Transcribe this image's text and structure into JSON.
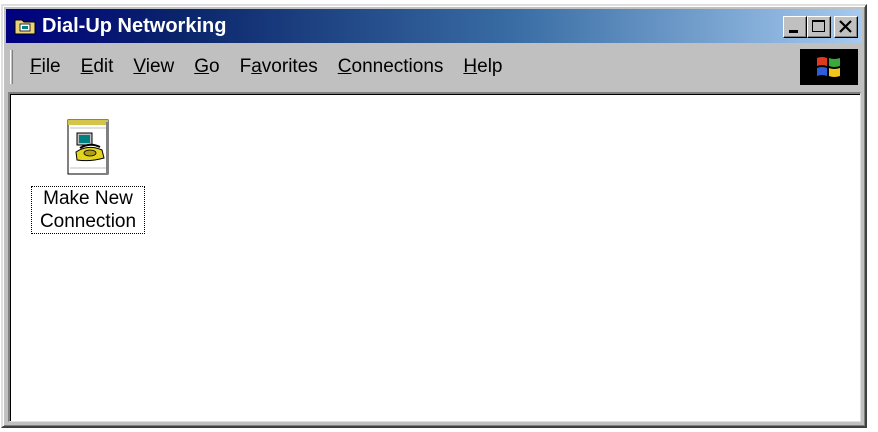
{
  "window": {
    "title": "Dial-Up Networking",
    "title_icon": "dial-up-folder-icon",
    "buttons": [
      "minimize",
      "maximize",
      "close"
    ]
  },
  "menubar": {
    "items": [
      {
        "label": "File",
        "accel": "F"
      },
      {
        "label": "Edit",
        "accel": "E"
      },
      {
        "label": "View",
        "accel": "V"
      },
      {
        "label": "Go",
        "accel": "G"
      },
      {
        "label": "Favorites",
        "accel": "a"
      },
      {
        "label": "Connections",
        "accel": "C"
      },
      {
        "label": "Help",
        "accel": "H"
      }
    ],
    "throbber_icon": "windows-logo-icon"
  },
  "content": {
    "items": [
      {
        "label_line1": "Make New",
        "label_line2": "Connection",
        "icon": "make-new-connection-icon"
      }
    ]
  },
  "colors": {
    "titlebar_start": "#000080",
    "titlebar_end": "#a6caf0",
    "face": "#c0c0c0",
    "content_bg": "#ffffff"
  }
}
